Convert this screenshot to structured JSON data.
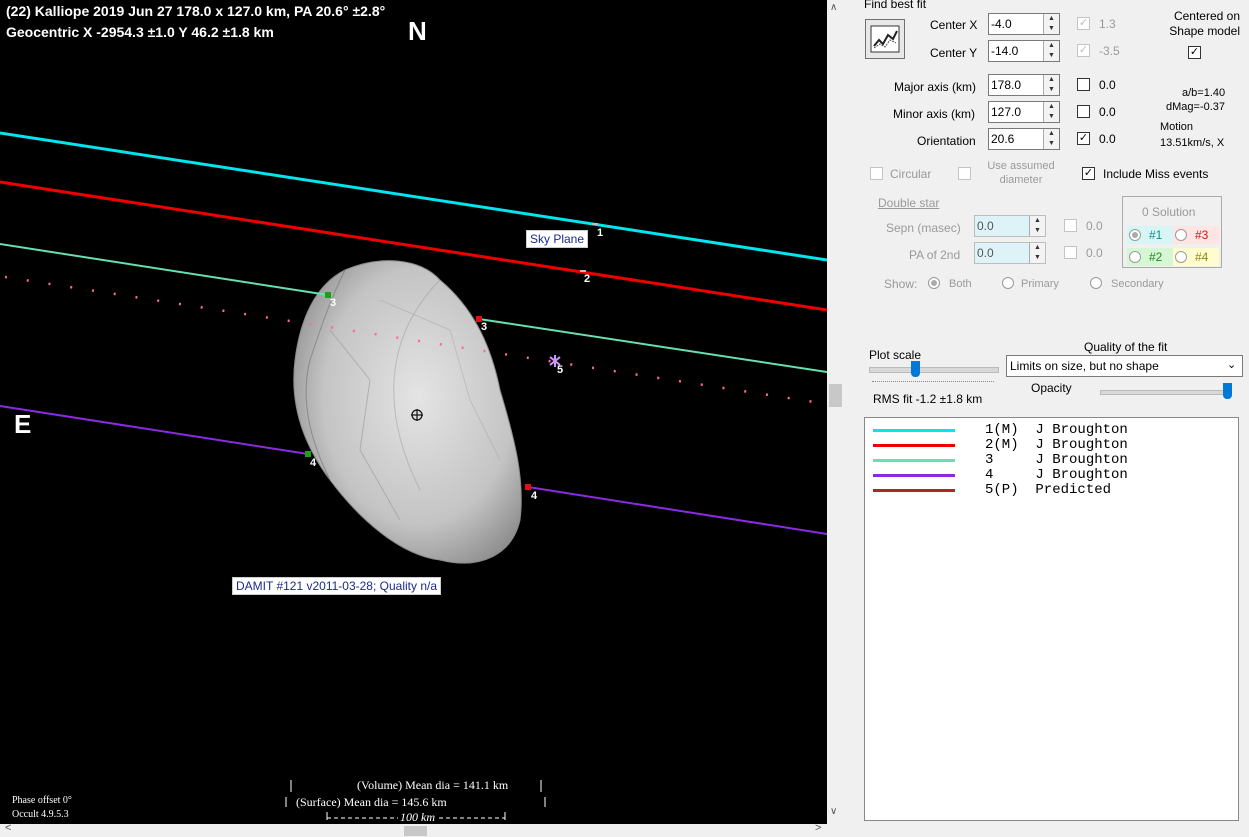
{
  "plot": {
    "title_line1": "(22) Kalliope  2019 Jun 27   178.0 x 127.0 km,  PA 20.6° ±2.8°",
    "title_line2": "Geocentric  X  -2954.3 ±1.0  Y 46.2 ±1.8 km",
    "north": "N",
    "east": "E",
    "sky_plane_label": "Sky Plane",
    "model_label": "DAMIT #121 v2011-03-28; Quality n/a",
    "volume_dia": "(Volume) Mean dia = 141.1 km",
    "surface_dia": "(Surface) Mean dia = 145.6 km",
    "scale_text": "100 km",
    "phase_offset": "Phase offset 0°",
    "version": "Occult 4.9.5.3",
    "chord_labels": [
      "1",
      "2",
      "3",
      "3",
      "4",
      "4",
      "5"
    ],
    "colors": {
      "chord1": "#00e5ee",
      "chord2": "#ee0000",
      "chord3": "#66e0b0",
      "chord4": "#8a2be2",
      "predicted": "#ff6a8a"
    }
  },
  "panel": {
    "find_best_fit": "Find best fit",
    "center_x_label": "Center X",
    "center_x_value": "-4.0",
    "center_x_uncert": "1.3",
    "center_y_label": "Center Y",
    "center_y_value": "-14.0",
    "center_y_uncert": "-3.5",
    "centered_on_label": "Centered on Shape model",
    "major_label": "Major axis (km)",
    "major_value": "178.0",
    "major_uncert": "0.0",
    "minor_label": "Minor axis (km)",
    "minor_value": "127.0",
    "minor_uncert": "0.0",
    "orient_label": "Orientation",
    "orient_value": "20.6",
    "orient_uncert": "0.0",
    "ab_ratio": "a/b=1.40",
    "dmag": "dMag=-0.37",
    "motion_label": "Motion",
    "motion_value": "13.51km/s, X",
    "circular_label": "Circular",
    "use_assumed_label": "Use assumed diameter",
    "include_miss_label": "Include Miss events",
    "double_star_label": "Double star",
    "sepn_label": "Sepn (masec)",
    "sepn_value": "0.0",
    "sepn_uncert": "0.0",
    "pa2_label": "PA of 2nd",
    "pa2_value": "0.0",
    "pa2_uncert": "0.0",
    "solution_title": "0 Solution",
    "sol1": "#1",
    "sol2": "#2",
    "sol3": "#3",
    "sol4": "#4",
    "show_label": "Show:",
    "show_both": "Both",
    "show_primary": "Primary",
    "show_secondary": "Secondary",
    "plot_scale_label": "Plot scale",
    "quality_label": "Quality of the fit",
    "quality_value": "Limits on size, but no shape",
    "opacity_label": "Opacity",
    "rms_fit": "RMS fit -1.2 ±1.8 km"
  },
  "legend": [
    {
      "text": "1(M)  J Broughton",
      "color": "#00e5ee"
    },
    {
      "text": "2(M)  J Broughton",
      "color": "#ee0000"
    },
    {
      "text": "3     J Broughton",
      "color": "#66e0b0"
    },
    {
      "text": "4     J Broughton",
      "color": "#8a2be2"
    },
    {
      "text": "5(P)  Predicted",
      "color": "#a52a2a"
    }
  ]
}
